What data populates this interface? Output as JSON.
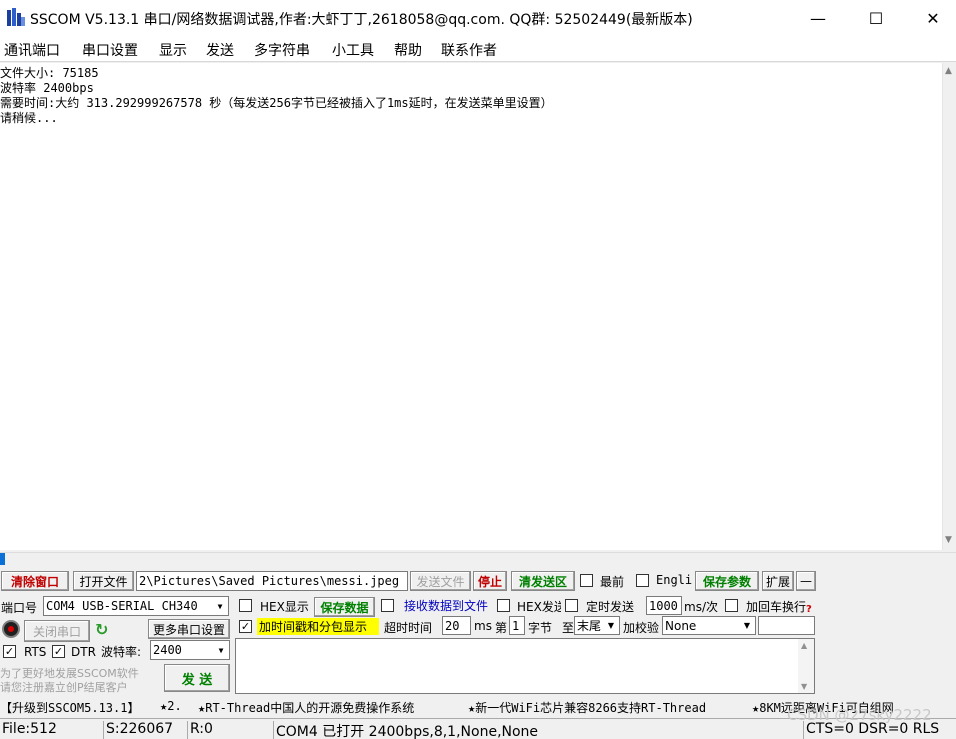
{
  "window": {
    "title": "SSCOM V5.13.1 串口/网络数据调试器,作者:大虾丁丁,2618058@qq.com. QQ群: 52502449(最新版本)",
    "minimize_glyph": "—",
    "maximize_glyph": "☐",
    "close_glyph": "✕"
  },
  "menu": [
    "通讯端口",
    "串口设置",
    "显示",
    "发送",
    "多字符串",
    "小工具",
    "帮助",
    "联系作者"
  ],
  "receive": {
    "lines": [
      "文件大小: 75185",
      "波特率 2400bps",
      "需要时间:大约 313.292999267578 秒（每发送256字节已经被插入了1ms延时，在发送菜单里设置）",
      "请稍候..."
    ]
  },
  "progress": {
    "fraction": 0.005
  },
  "toolbar": {
    "clear_window": "清除窗口",
    "open_file": "打开文件",
    "file_path": "2\\Pictures\\Saved Pictures\\messi.jpeg",
    "send_file": "发送文件",
    "stop": "停止",
    "clear_send": "清发送区",
    "top_label": "最前",
    "english_label": "Engli",
    "save_params": "保存参数",
    "expand": "扩展",
    "collapse": "—"
  },
  "port": {
    "port_label": "端口号",
    "port_value": "COM4 USB-SERIAL CH340",
    "close_port": "关闭串口",
    "more_settings": "更多串口设置",
    "rts_label": "RTS",
    "dtr_label": "DTR",
    "baud_label": "波特率:",
    "baud_value": "2400",
    "promo_line1": "为了更好地发展SSCOM软件",
    "promo_line2": "请您注册嘉立创P结尾客户"
  },
  "options": {
    "hex_display": "HEX显示",
    "save_data": "保存数据",
    "recv_to_file": "接收数据到文件",
    "hex_send": "HEX发送",
    "timed_send": "定时发送",
    "interval_value": "1000",
    "interval_unit": "ms/次",
    "add_crlf": "加回车换行",
    "timestamp": "加时间戳和分包显示",
    "timeout_label": "超时时间",
    "timeout_value": "20",
    "timeout_unit": "ms",
    "nth_label": "第",
    "nth_value": "1",
    "byte_label": "字节",
    "to_label": "至",
    "end_value": "末尾",
    "checksum_label": "加校验",
    "checksum_value": "None",
    "send_button": "发 送"
  },
  "news": [
    "【升级到SSCOM5.13.1】",
    "★2.",
    "★RT-Thread中国人的开源免费操作系统",
    "★新一代WiFi芯片兼容8266支持RT-Thread",
    "★8KM远距离WiFi可自组网"
  ],
  "status": {
    "file": "File:512",
    "sent": "S:226067",
    "received": "R:0",
    "port_status": "COM4 已打开  2400bps,8,1,None,None",
    "lines": "CTS=0 DSR=0 RLS"
  },
  "watermark": "CSDN @27sky2222",
  "colors": {
    "accent": "#0a6fd6",
    "highlight": "#ffff00",
    "red": "#c00000",
    "green": "#008000"
  }
}
